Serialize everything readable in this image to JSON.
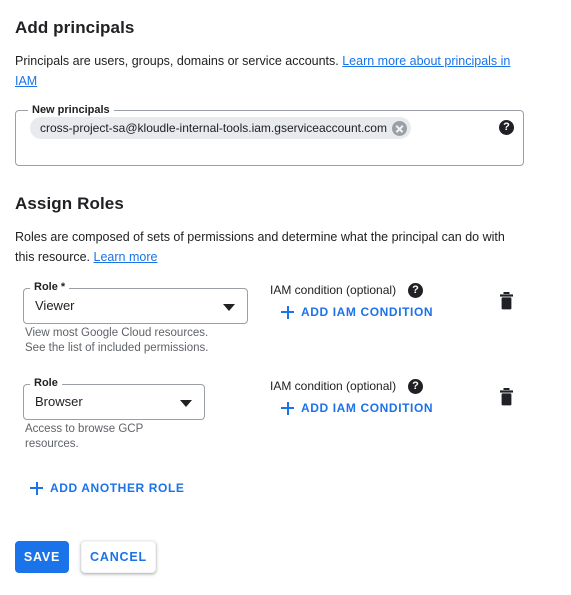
{
  "add_principals": {
    "title": "Add principals",
    "description_before_link": "Principals are users, groups, domains or service accounts. ",
    "link_text": "Learn more about principals in IAM",
    "field_label": "New principals",
    "chip_value": "cross-project-sa@kloudle-internal-tools.iam.gserviceaccount.com",
    "chip_remove_icon": "close-circle-icon",
    "help_icon": "?"
  },
  "assign_roles": {
    "title": "Assign Roles",
    "description_before_link": "Roles are composed of sets of permissions and determine what the principal can do with this resource. ",
    "link_text": "Learn more",
    "rows": [
      {
        "role_label": "Role *",
        "role_value": "Viewer",
        "helper_line_1": "View most Google Cloud resources.",
        "helper_line_2": "See the list of included permissions.",
        "condition_label": "IAM condition (optional)",
        "condition_help_icon": "?",
        "add_condition_label": "ADD IAM CONDITION",
        "delete_icon": "trash-icon"
      },
      {
        "role_label": "Role",
        "role_value": "Browser",
        "helper_line_1": "Access to browse GCP",
        "helper_line_2": "resources.",
        "condition_label": "IAM condition (optional)",
        "condition_help_icon": "?",
        "add_condition_label": "ADD IAM CONDITION",
        "delete_icon": "trash-icon"
      }
    ],
    "add_another_role_label": "ADD ANOTHER ROLE"
  },
  "actions": {
    "save_label": "SAVE",
    "cancel_label": "CANCEL"
  },
  "colors": {
    "accent_blue": "#1a73e8",
    "text_primary": "#202124",
    "text_secondary": "#5f6368",
    "chip_background": "#e8eaed",
    "border": "#9aa0a6"
  }
}
